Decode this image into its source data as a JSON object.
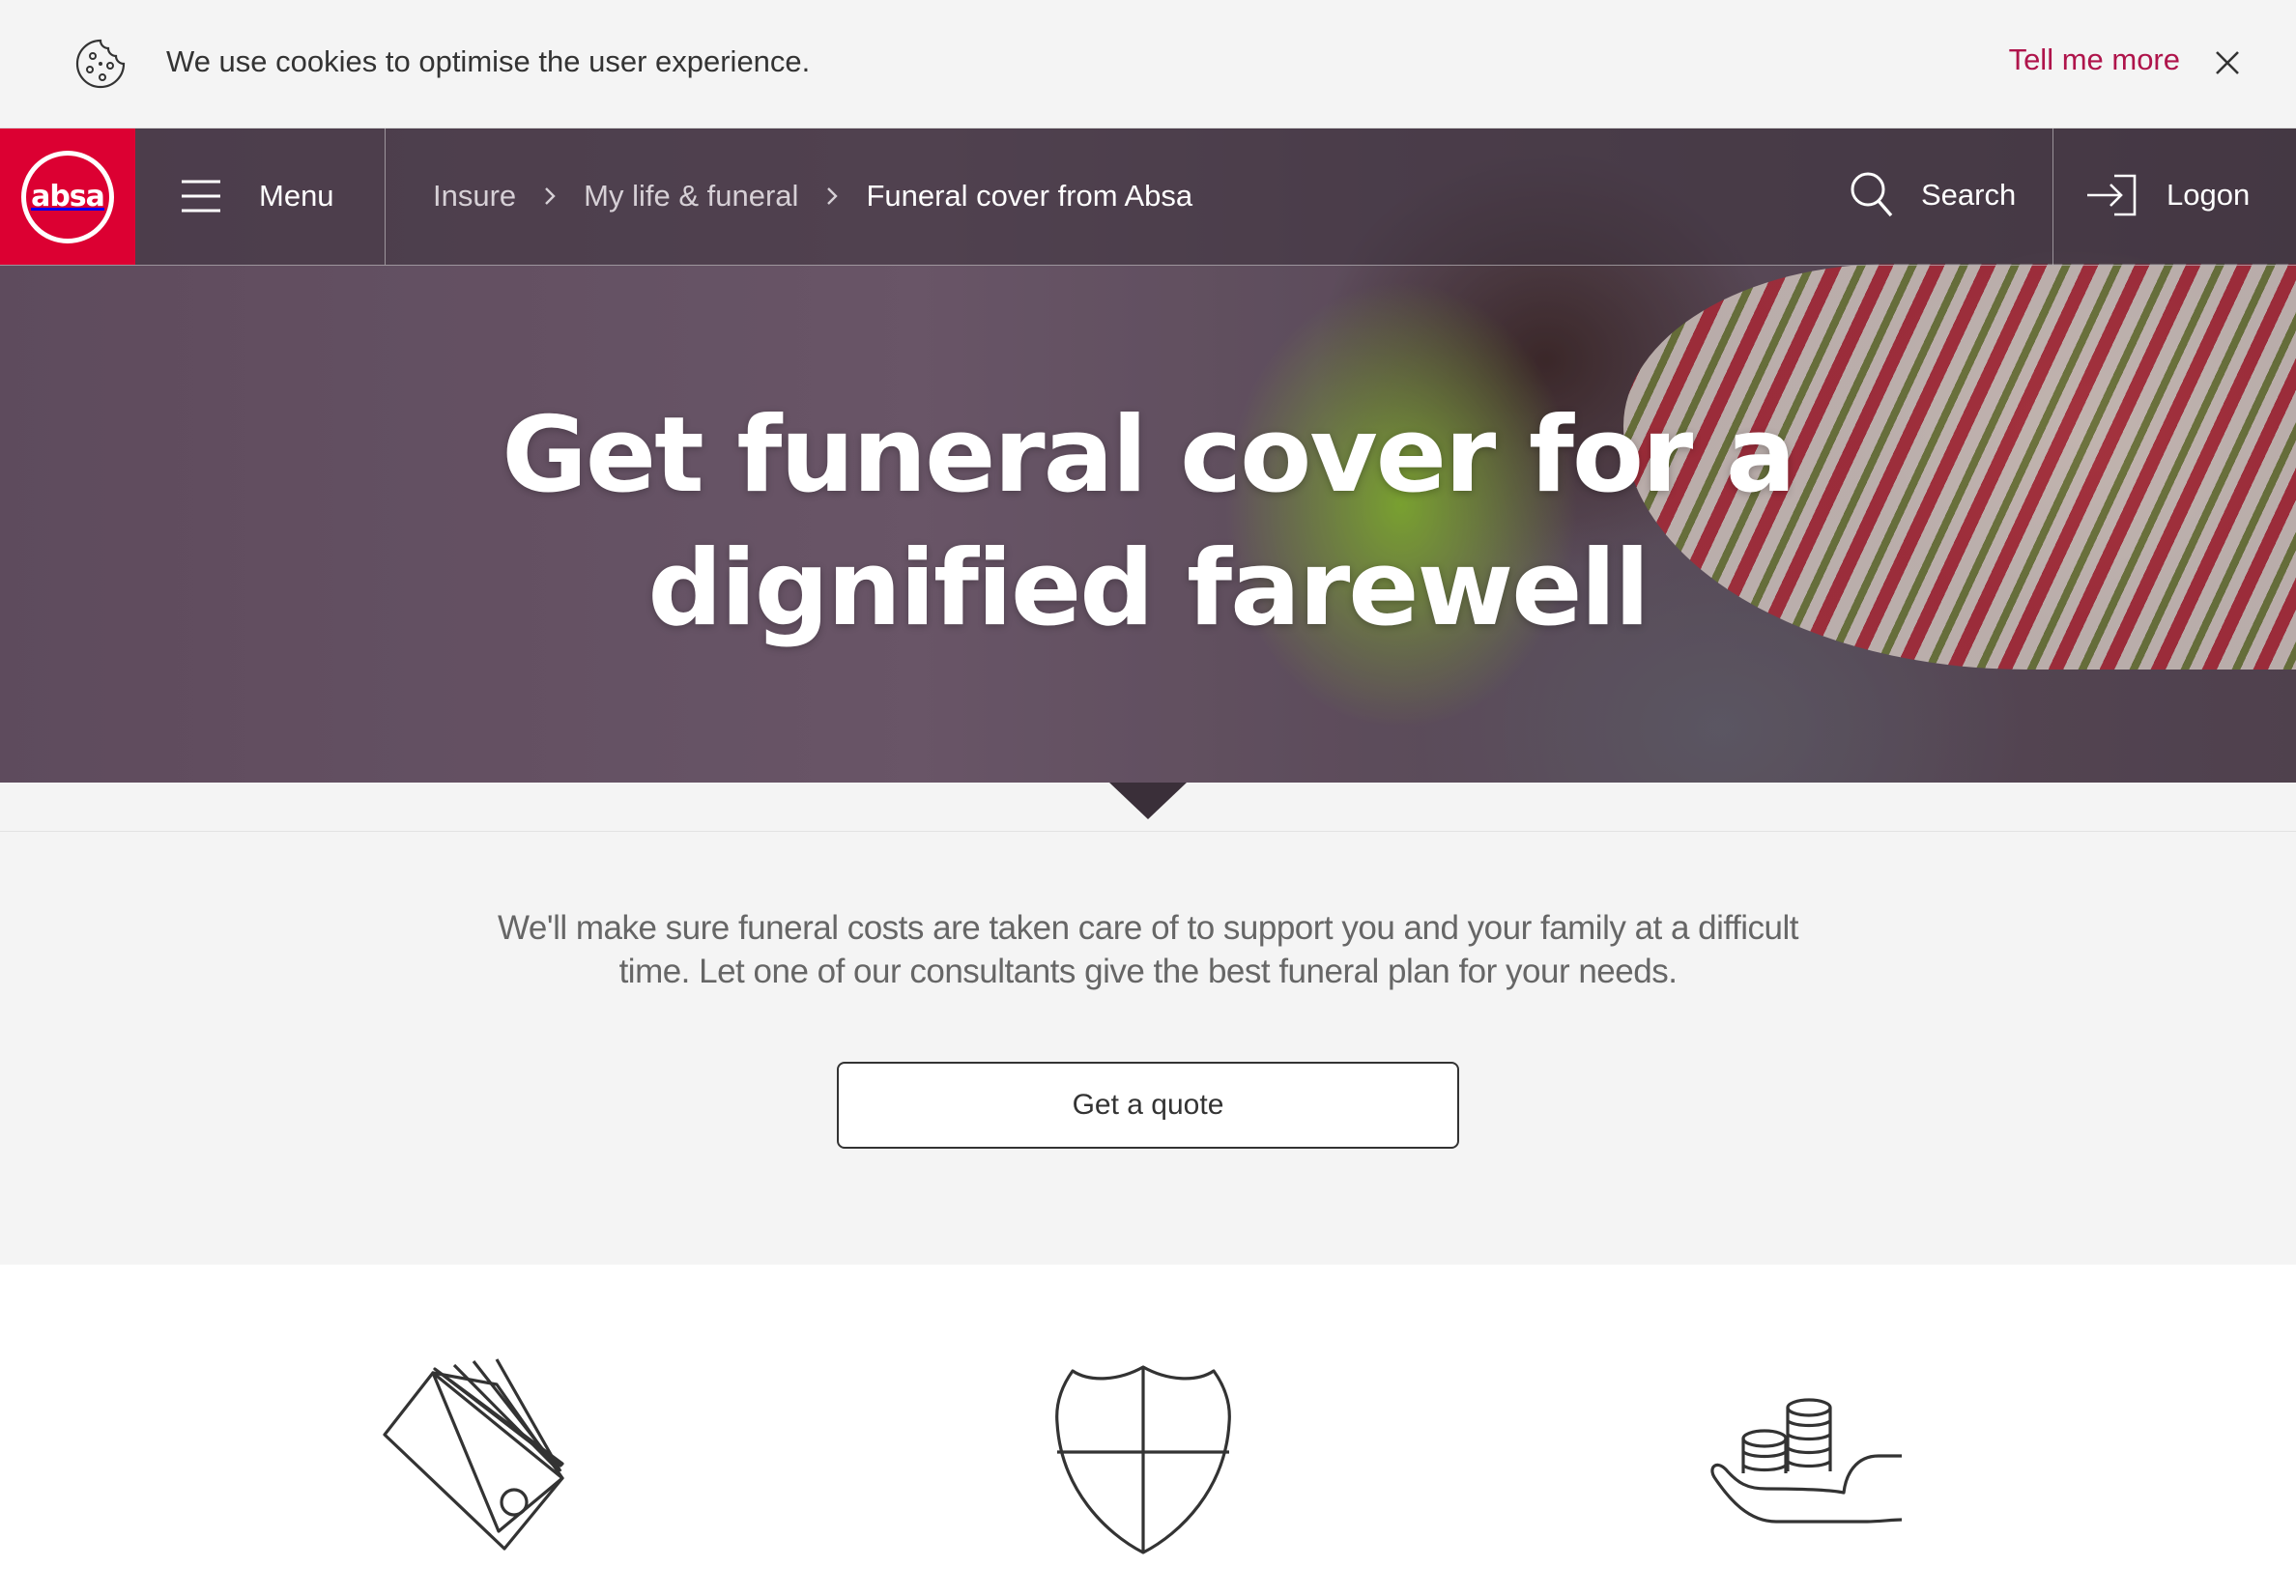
{
  "cookie_bar": {
    "message": "We use cookies to optimise the user experience.",
    "link_label": "Tell me more"
  },
  "nav": {
    "logo_text": "absa",
    "menu_label": "Menu",
    "breadcrumb": [
      {
        "label": "Insure"
      },
      {
        "label": "My life & funeral"
      },
      {
        "label": "Funeral cover from Absa"
      }
    ],
    "search_label": "Search",
    "logon_label": "Logon"
  },
  "hero": {
    "title_line1": "Get funeral cover for a",
    "title_line2": "dignified farewell"
  },
  "intro": {
    "text": "We'll make sure funeral costs are taken care of to support you and your family at a difficult time. Let one of our consultants give the best funeral plan for your needs.",
    "button_label": "Get a quote"
  },
  "features": [
    {
      "icon": "price-tags-icon"
    },
    {
      "icon": "shield-icon"
    },
    {
      "icon": "hand-coins-icon"
    }
  ],
  "colors": {
    "brand_red": "#dc0032",
    "link_red": "#af144b",
    "intro_bg": "#f4f4f4"
  }
}
